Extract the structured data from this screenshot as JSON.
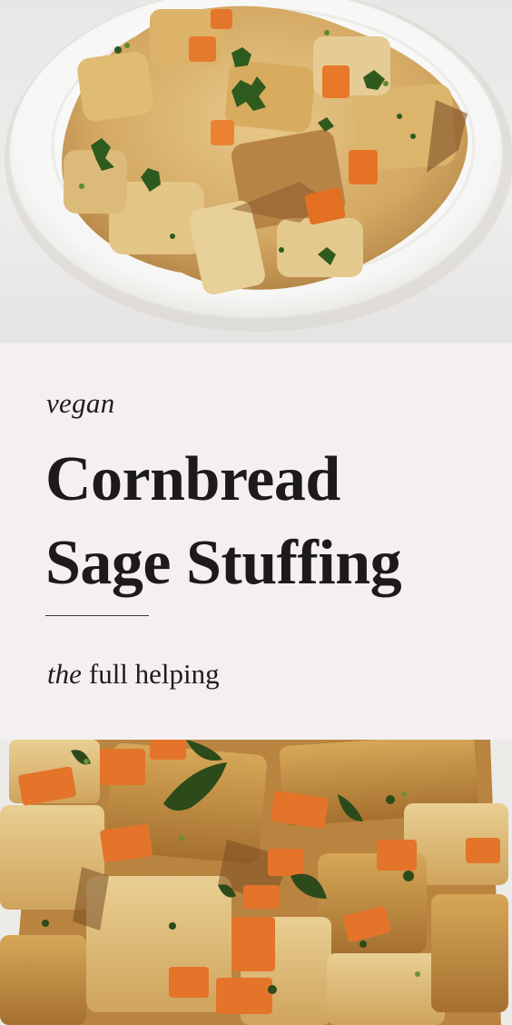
{
  "pin": {
    "top_photo": {
      "subject": "cornbread stuffing on a white plate"
    },
    "kicker": "vegan",
    "title_line_1": "Cornbread",
    "title_line_2": "Sage Stuffing",
    "brand": {
      "italic": "the",
      "rest": "full helping"
    },
    "bottom_photo": {
      "subject": "cornbread stuffing close-up in a baking dish"
    }
  },
  "colors": {
    "panel": "#f4f0f1",
    "text": "#1d1a1b",
    "cornbread": "#d9b36a",
    "carrot": "#e0782e",
    "herb": "#2f4a1c",
    "plate": "#fbfbfa"
  }
}
